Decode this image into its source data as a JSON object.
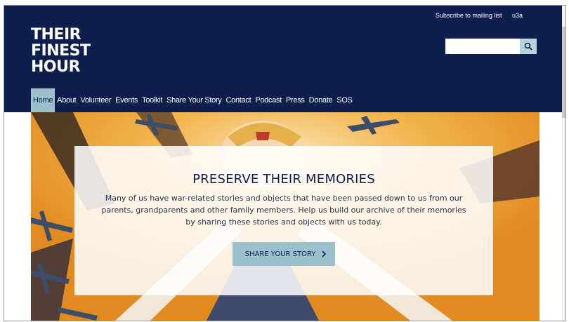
{
  "header": {
    "logo_lines": [
      "THEIR",
      "FINEST",
      "HOUR"
    ],
    "top_links": [
      "Subscribe to mailing list",
      "u3a"
    ],
    "search": {
      "placeholder": "",
      "value": "",
      "icon": "search-icon"
    }
  },
  "nav": {
    "items": [
      "Home",
      "About",
      "Volunteer",
      "Events",
      "Toolkit",
      "Share Your Story",
      "Contact",
      "Podcast",
      "Press",
      "Donate",
      "SOS"
    ],
    "active": "Home"
  },
  "hero": {
    "title": "PRESERVE THEIR MEMORIES",
    "text": "Many of us have war-related stories and objects that have been passed down to us from our parents, grandparents and other family members. Help us build our archive of their memories by sharing these stories and objects with us today.",
    "cta_label": "SHARE YOUR STORY",
    "cta_icon": "chevron-right-icon"
  },
  "colors": {
    "header_bg": "#0e1e4d",
    "accent": "#9cc1cd",
    "hero_orange": "#e89a2a"
  }
}
